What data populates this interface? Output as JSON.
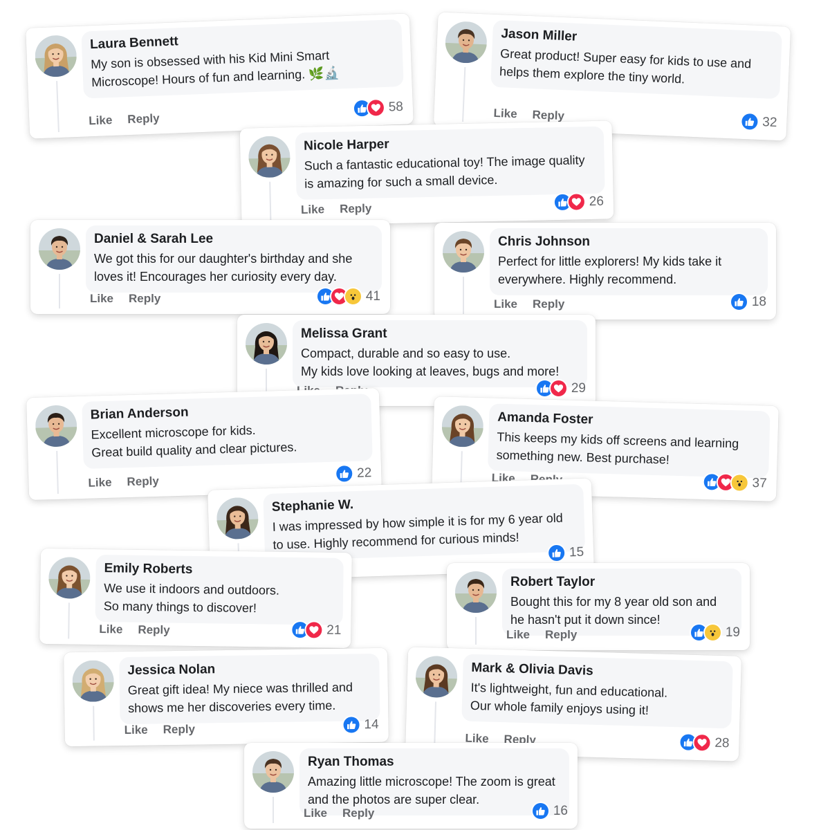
{
  "labels": {
    "like": "Like",
    "reply": "Reply"
  },
  "colors": {
    "like": "#1877f2",
    "love": "#f0284a",
    "wow": "#f7c73a"
  },
  "comments": [
    {
      "name": "Laura Bennett",
      "text": "My son is obsessed with his Kid Mini Smart Microscope! Hours of fun and learning. 🌿🔬",
      "reactions": [
        "like-icon",
        "love-icon"
      ],
      "count": "58"
    },
    {
      "name": "Jason Miller",
      "text": "Great product! Super easy for kids to use and helps them explore the tiny world.",
      "reactions": [
        "like-icon"
      ],
      "count": "32"
    },
    {
      "name": "Nicole Harper",
      "text": "Such a fantastic educational toy! The image quality is amazing for such a small device.",
      "reactions": [
        "like-icon",
        "love-icon"
      ],
      "count": "26"
    },
    {
      "name": "Daniel & Sarah Lee",
      "text": "We got this for our daughter's birthday and she loves it! Encourages her curiosity every day.",
      "reactions": [
        "like-icon",
        "love-icon",
        "wow-icon"
      ],
      "count": "41"
    },
    {
      "name": "Chris Johnson",
      "text": "Perfect for little explorers! My kids take it everywhere. Highly recommend.",
      "reactions": [
        "like-icon"
      ],
      "count": "18"
    },
    {
      "name": "Melissa Grant",
      "text": "Compact, durable and so easy to use.\nMy kids love looking at leaves, bugs and more!",
      "reactions": [
        "like-icon",
        "love-icon"
      ],
      "count": "29"
    },
    {
      "name": "Brian Anderson",
      "text": "Excellent microscope for kids.\nGreat build quality and clear pictures.",
      "reactions": [
        "like-icon"
      ],
      "count": "22"
    },
    {
      "name": "Amanda Foster",
      "text": "This keeps my kids off screens and learning something new. Best purchase!",
      "reactions": [
        "like-icon",
        "love-icon",
        "wow-icon"
      ],
      "count": "37"
    },
    {
      "name": "Stephanie W.",
      "text": "I was impressed by how simple it is for my 6 year old to use. Highly recommend for curious minds!",
      "reactions": [
        "like-icon"
      ],
      "count": "15"
    },
    {
      "name": "Emily Roberts",
      "text": "We use it indoors and outdoors.\nSo many things to discover!",
      "reactions": [
        "like-icon",
        "love-icon"
      ],
      "count": "21"
    },
    {
      "name": "Robert Taylor",
      "text": "Bought this for my 8 year old son and he hasn't put it down since!",
      "reactions": [
        "like-icon",
        "wow-icon"
      ],
      "count": "19"
    },
    {
      "name": "Jessica Nolan",
      "text": "Great gift idea! My niece was thrilled and shows me her discoveries every time.",
      "reactions": [
        "like-icon"
      ],
      "count": "14"
    },
    {
      "name": "Mark & Olivia Davis",
      "text": "It's lightweight, fun and educational.\nOur whole family enjoys using it!",
      "reactions": [
        "like-icon",
        "love-icon"
      ],
      "count": "28"
    },
    {
      "name": "Ryan Thomas",
      "text": "Amazing little microscope! The zoom is great and the photos are super clear.",
      "reactions": [
        "like-icon"
      ],
      "count": "16"
    }
  ]
}
